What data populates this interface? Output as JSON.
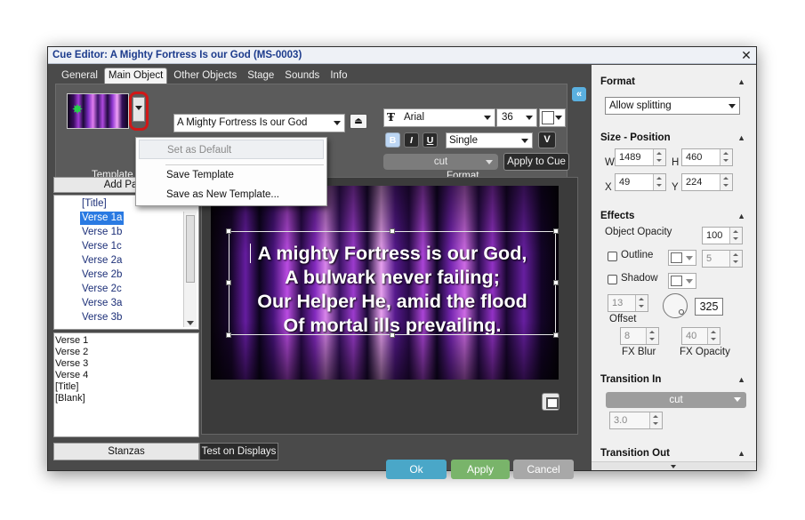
{
  "window": {
    "title": "Cue Editor: A Mighty Fortress Is our God (MS-0003)",
    "close_glyph": "✕"
  },
  "tabs": [
    {
      "label": "General",
      "active": false
    },
    {
      "label": "Main Object",
      "active": true
    },
    {
      "label": "Other Objects",
      "active": false
    },
    {
      "label": "Stage",
      "active": false
    },
    {
      "label": "Sounds",
      "active": false
    },
    {
      "label": "Info",
      "active": false
    }
  ],
  "toolbar": {
    "template_label": "Template",
    "format_label": "Format",
    "song_select": "A Mighty Fortress Is our God",
    "font": "Arial",
    "font_icon": "Ŧ",
    "font_size": "36",
    "bold": "B",
    "italic": "I",
    "underline": "U",
    "spacing": "Single",
    "v_label": "V",
    "transition": "cut",
    "apply_to_cue": "Apply to Cue",
    "load_icon": "⏏"
  },
  "context_menu": {
    "items": [
      {
        "label": "Set as Default",
        "disabled": true
      },
      {
        "label": "Save Template",
        "disabled": false
      },
      {
        "label": "Save as New Template...",
        "disabled": false
      }
    ]
  },
  "left_panel": {
    "add_page": "Add Page",
    "verses": [
      {
        "label": "[Title]",
        "selected": false
      },
      {
        "label": "Verse 1a",
        "selected": true
      },
      {
        "label": "Verse 1b",
        "selected": false
      },
      {
        "label": "Verse 1c",
        "selected": false
      },
      {
        "label": "Verse 2a",
        "selected": false
      },
      {
        "label": "Verse 2b",
        "selected": false
      },
      {
        "label": "Verse 2c",
        "selected": false
      },
      {
        "label": "Verse 3a",
        "selected": false
      },
      {
        "label": "Verse 3b",
        "selected": false
      }
    ],
    "order": [
      "Verse 1",
      "Verse 2",
      "Verse 3",
      "Verse 4",
      "[Title]",
      "[Blank]"
    ],
    "stanzas_btn": "Stanzas",
    "test_btn": "Test on Displays"
  },
  "preview": {
    "lyrics": [
      "A mighty Fortress is our God,",
      "A bulwark never failing;",
      "Our Helper He, amid the flood",
      "Of mortal ills prevailing."
    ]
  },
  "buttons": {
    "ok": "Ok",
    "apply": "Apply",
    "cancel": "Cancel",
    "collapse": "«"
  },
  "right_panel": {
    "format": {
      "title": "Format",
      "splitting": "Allow splitting"
    },
    "size_position": {
      "title": "Size - Position",
      "w_label": "W",
      "w": "1489",
      "h_label": "H",
      "h": "460",
      "x_label": "X",
      "x": "49",
      "y_label": "Y",
      "y": "224"
    },
    "effects": {
      "title": "Effects",
      "opacity_label": "Object Opacity",
      "opacity": "100",
      "outline_label": "Outline",
      "outline_size": "5",
      "shadow_label": "Shadow",
      "offset_value": "13",
      "offset_label": "Offset",
      "angle": "325",
      "blur_value": "8",
      "blur_label": "FX Blur",
      "fx_opacity_value": "40",
      "fx_opacity_label": "FX Opacity"
    },
    "transition_in": {
      "title": "Transition In",
      "type": "cut",
      "duration": "3.0"
    },
    "transition_out": {
      "title": "Transition Out"
    },
    "collapse_glyph": "▲"
  }
}
